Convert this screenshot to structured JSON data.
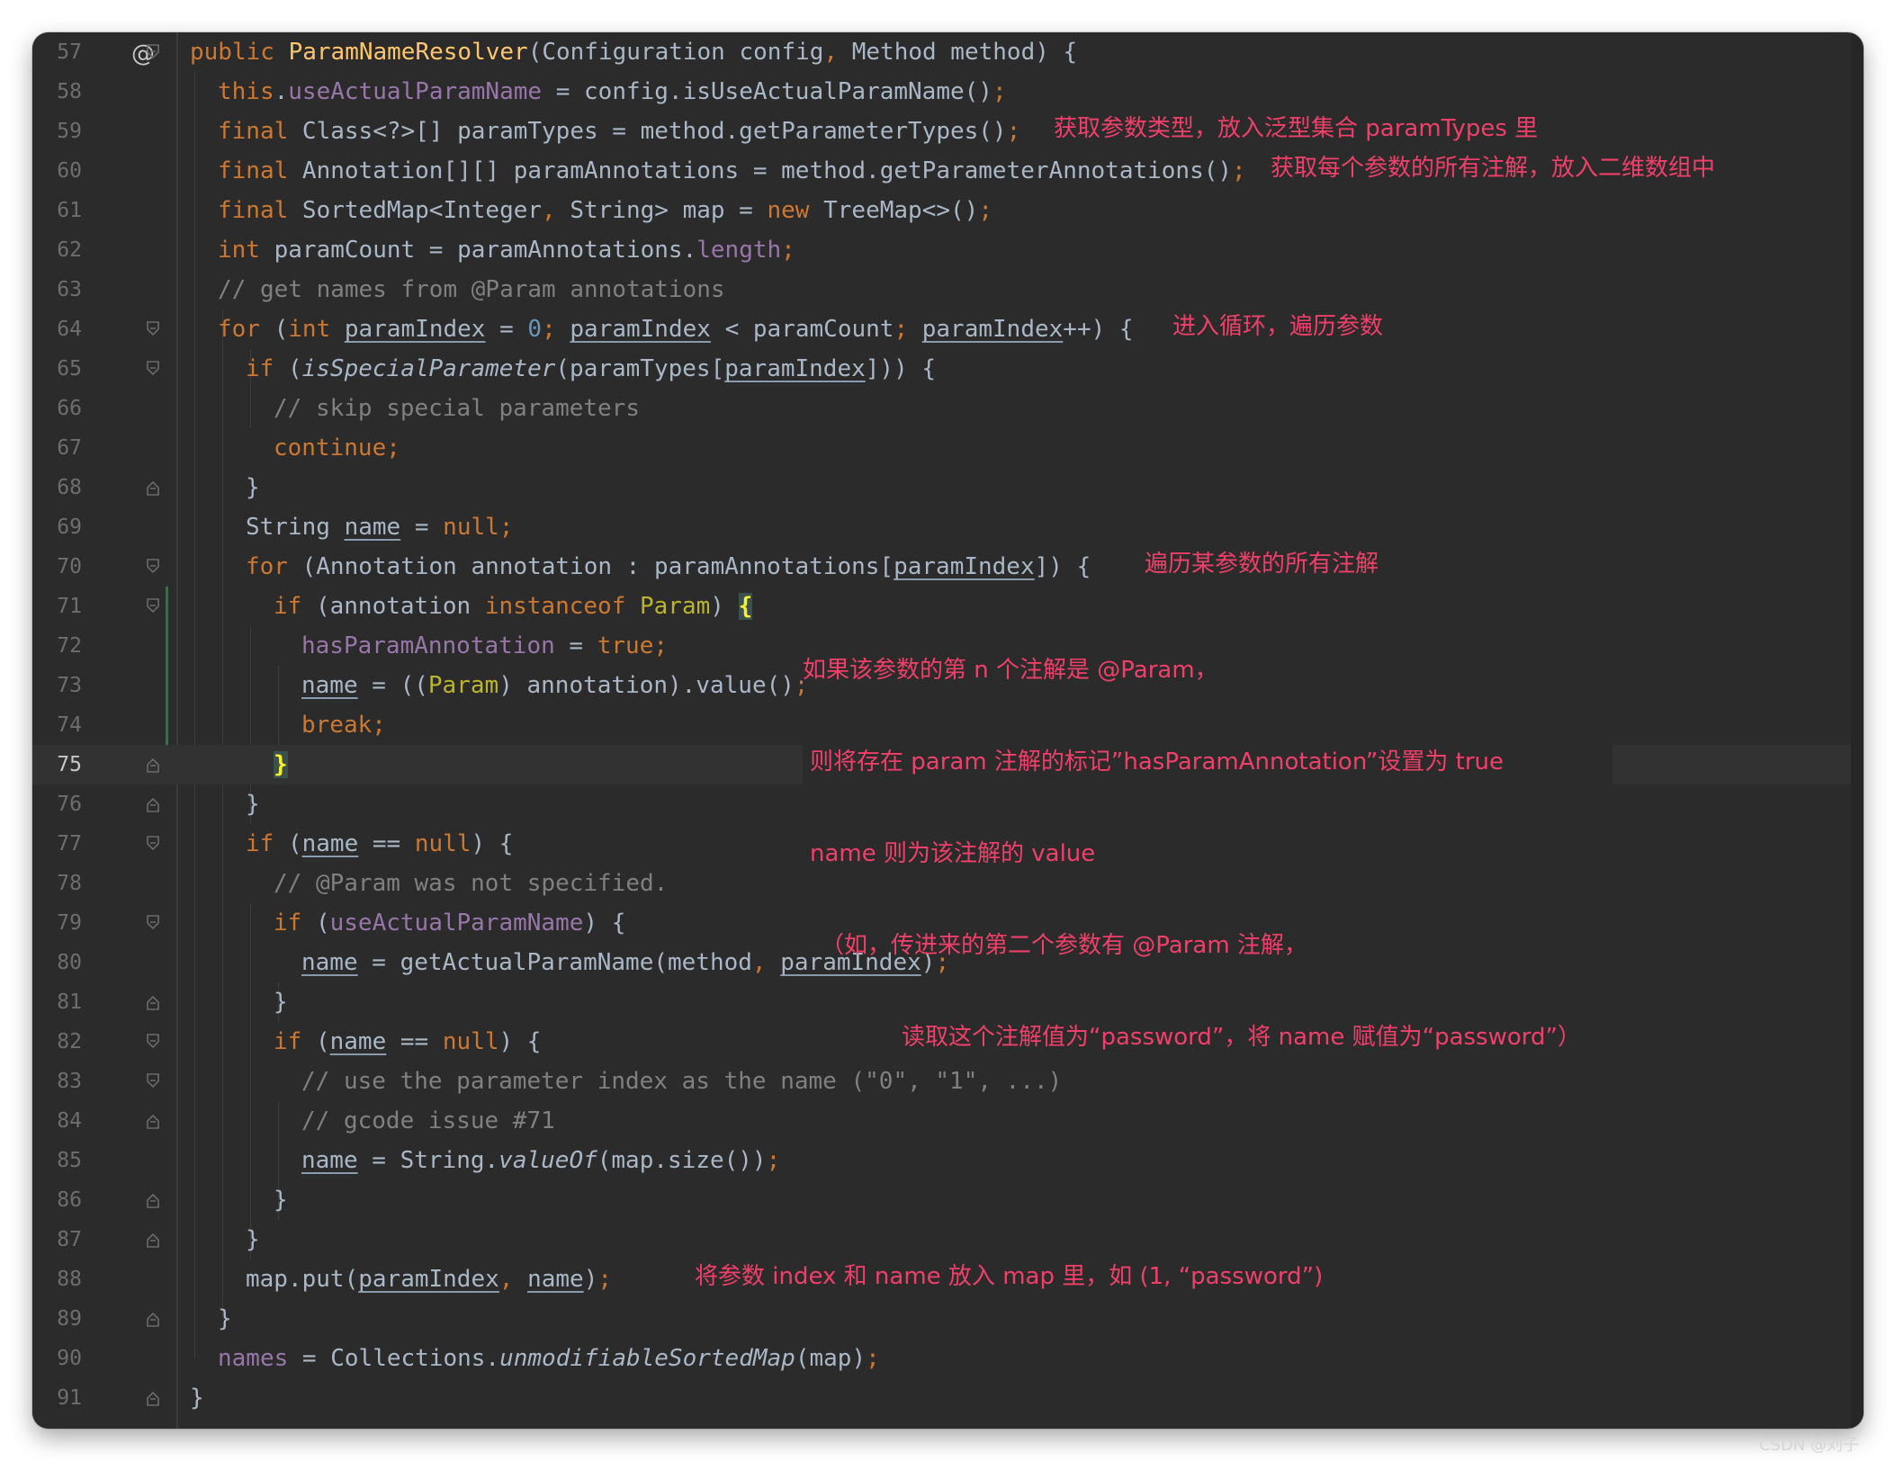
{
  "editor": {
    "gutter_marker": "@",
    "current_line": "75",
    "lines": [
      {
        "n": "57"
      },
      {
        "n": "58"
      },
      {
        "n": "59"
      },
      {
        "n": "60"
      },
      {
        "n": "61"
      },
      {
        "n": "62"
      },
      {
        "n": "63"
      },
      {
        "n": "64"
      },
      {
        "n": "65"
      },
      {
        "n": "66"
      },
      {
        "n": "67"
      },
      {
        "n": "68"
      },
      {
        "n": "69"
      },
      {
        "n": "70"
      },
      {
        "n": "71"
      },
      {
        "n": "72"
      },
      {
        "n": "73"
      },
      {
        "n": "74"
      },
      {
        "n": "75"
      },
      {
        "n": "76"
      },
      {
        "n": "77"
      },
      {
        "n": "78"
      },
      {
        "n": "79"
      },
      {
        "n": "80"
      },
      {
        "n": "81"
      },
      {
        "n": "82"
      },
      {
        "n": "83"
      },
      {
        "n": "84"
      },
      {
        "n": "85"
      },
      {
        "n": "86"
      },
      {
        "n": "87"
      },
      {
        "n": "88"
      },
      {
        "n": "89"
      },
      {
        "n": "90"
      },
      {
        "n": "91"
      }
    ],
    "code": {
      "l57": {
        "a": "public ",
        "b": "ParamNameResolver",
        "c": "(Configuration config",
        "d": ", ",
        "e": "Method method) {"
      },
      "l58": {
        "a": "this",
        "b": ".",
        "c": "useActualParamName",
        "d": " = config.isUseActualParamName()",
        "e": ";"
      },
      "l59": {
        "a": "final ",
        "b": "Class<?>[] paramTypes = method.getParameterTypes()",
        "c": ";"
      },
      "l60": {
        "a": "final ",
        "b": "Annotation[][] paramAnnotations = method.getParameterAnnotations()",
        "c": ";"
      },
      "l61": {
        "a": "final ",
        "b": "SortedMap<Integer",
        "c": ", ",
        "d": "String> map = ",
        "e": "new ",
        "f": "TreeMap<>()",
        "g": ";"
      },
      "l62": {
        "a": "int ",
        "b": "paramCount = paramAnnotations.",
        "c": "length",
        "d": ";"
      },
      "l63": {
        "a": "// get names from @Param annotations"
      },
      "l64": {
        "a": "for ",
        "b": "(",
        "c": "int ",
        "d": "paramIndex",
        "e": " = ",
        "f": "0",
        "g": "; ",
        "h": "paramIndex",
        "i": " < paramCount",
        "j": "; ",
        "k": "paramIndex",
        "l": "++) {"
      },
      "l65": {
        "a": "if ",
        "b": "(",
        "c": "isSpecialParameter",
        "d": "(paramTypes[",
        "e": "paramIndex",
        "f": "])) {"
      },
      "l66": {
        "a": "// skip special parameters"
      },
      "l67": {
        "a": "continue",
        "b": ";"
      },
      "l68": {
        "a": "}"
      },
      "l69": {
        "a": "String ",
        "b": "name",
        "c": " = ",
        "d": "null",
        "e": ";"
      },
      "l70": {
        "a": "for ",
        "b": "(Annotation annotation : paramAnnotations[",
        "c": "paramIndex",
        "d": "]) {"
      },
      "l71": {
        "a": "if ",
        "b": "(annotation ",
        "c": "instanceof ",
        "d": "Param",
        "e": ") ",
        "f": "{"
      },
      "l72": {
        "a": "hasParamAnnotation",
        "b": " = ",
        "c": "true",
        "d": ";"
      },
      "l73": {
        "a": "name",
        "b": " = ((",
        "c": "Param",
        "d": ") annotation).value()",
        "e": ";"
      },
      "l74": {
        "a": "break",
        "b": ";"
      },
      "l75": {
        "a": "}"
      },
      "l76": {
        "a": "}"
      },
      "l77": {
        "a": "if ",
        "b": "(",
        "c": "name",
        "d": " == ",
        "e": "null",
        "f": ") {"
      },
      "l78": {
        "a": "// @Param was not specified."
      },
      "l79": {
        "a": "if ",
        "b": "(",
        "c": "useActualParamName",
        "d": ") {"
      },
      "l80": {
        "a": "name",
        "b": " = getActualParamName(method",
        "c": ", ",
        "d": "paramIndex",
        "e": ")",
        "f": ";"
      },
      "l81": {
        "a": "}"
      },
      "l82": {
        "a": "if ",
        "b": "(",
        "c": "name",
        "d": " == ",
        "e": "null",
        "f": ") {"
      },
      "l83": {
        "a": "// use the parameter index as the name (\"0\", \"1\", ...)"
      },
      "l84": {
        "a": "// gcode issue #71"
      },
      "l85": {
        "a": "name",
        "b": " = String.",
        "c": "valueOf",
        "d": "(map.size())",
        "e": ";"
      },
      "l86": {
        "a": "}"
      },
      "l87": {
        "a": "}"
      },
      "l88": {
        "a": "map.put(",
        "b": "paramIndex",
        "c": ", ",
        "d": "name",
        "e": ")",
        "f": ";"
      },
      "l89": {
        "a": "}"
      },
      "l90": {
        "a": "names",
        "b": " = Collections.",
        "c": "unmodifiableSortedMap",
        "d": "(map)",
        "e": ";"
      },
      "l91": {
        "a": "}"
      }
    }
  },
  "annotations": {
    "a59": "获取参数类型，放入泛型集合 paramTypes 里",
    "a60": "获取每个参数的所有注解，放入二维数组中",
    "a64": "进入循环，遍历参数",
    "a70": "遍历某参数的所有注解",
    "a71_1": "如果该参数的第 n 个注解是 @Param，",
    "a71_2": "则将存在 param 注解的标记”hasParamAnnotation”设置为 true",
    "a71_3": "name 则为该注解的 value",
    "a71_4": "（如，传进来的第二个参数有 @Param 注解，",
    "a71_5": "读取这个注解值为“password”，将 name 赋值为“password”）",
    "a88": "将参数 index 和 name 放入 map 里，如 (1, “password”)"
  },
  "watermark": "CSDN @刘子"
}
